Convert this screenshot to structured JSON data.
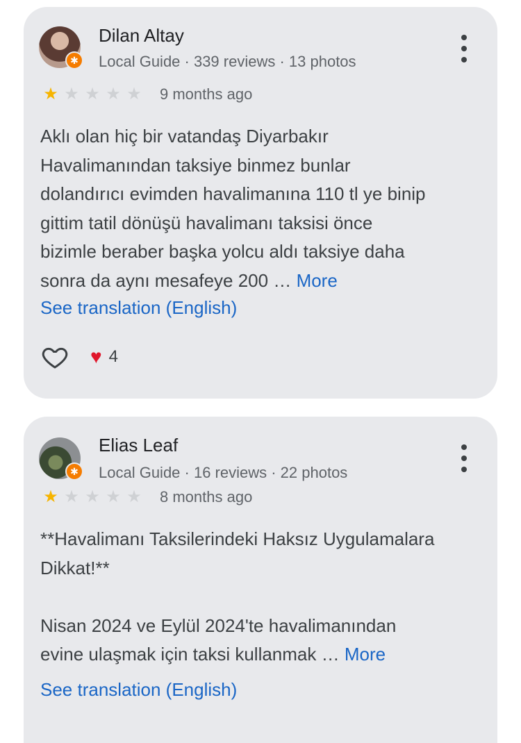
{
  "reviews": [
    {
      "name": "Dilan Altay",
      "meta": "Local Guide · 339 reviews · 13 photos",
      "rating": 1,
      "rating_max": 5,
      "time": "9 months ago",
      "text_lines": [
        "Aklı olan hiç bir vatandaş Diyarbakır",
        "Havalimanından taksiye binmez bunlar",
        "dolandırıcı evimden havalimanına 110 tl ye binip",
        "gittim tatil dönüşü havalimanı taksisi önce",
        "bizimle beraber başka yolcu aldı taksiye daha",
        "sonra da aynı mesafeye 200 …"
      ],
      "more_label": "More",
      "translate_label": "See translation (English)",
      "reaction_count": "4",
      "reaction_emoji": "❤️"
    },
    {
      "name": "Elias Leaf",
      "meta": "Local Guide · 16 reviews · 22 photos",
      "rating": 1,
      "rating_max": 5,
      "time": "8 months ago",
      "para1_lines": [
        "**Havalimanı Taksilerindeki Haksız Uygulamalara",
        "Dikkat!**"
      ],
      "para2_lines": [
        "Nisan 2024 ve Eylül 2024'te havalimanından",
        "evine ulaşmak için taksi kullanmak …"
      ],
      "more_label": "More",
      "translate_label": "See translation (English)"
    }
  ],
  "icons": {
    "menu": "more-vert-icon",
    "like": "heart-outline-icon",
    "local_guide_badge": "star-badge-icon"
  },
  "colors": {
    "card_bg": "#e8e9ec",
    "link": "#1a66c6",
    "star_on": "#f6b400",
    "star_off": "#cfd1d4",
    "heart": "#e0162b",
    "badge": "#f57c00"
  }
}
